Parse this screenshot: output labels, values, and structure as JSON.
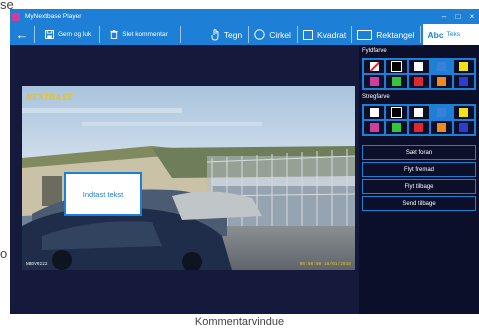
{
  "background": {
    "top_text": "se",
    "mid_text": "o"
  },
  "window": {
    "title": "MyNextbase Player",
    "controls": [
      "–",
      "□",
      "×"
    ]
  },
  "toolbar": {
    "back_icon": "back-arrow-icon",
    "save_close": "Gem og luk",
    "delete_comment": "Slet kommentar",
    "draw": "Tegn",
    "circle": "Cirkel",
    "square": "Kvadrat",
    "rectangle": "Rektangel",
    "text_icon": "Abc",
    "text": "Teks"
  },
  "video": {
    "logo": "NEXTBASE",
    "overlay_left": "NBDVR222",
    "overlay_right": "00:00:00 18/01/2018",
    "text_box": "Indtast tekst"
  },
  "panel": {
    "fill_label": "Fyldfarve",
    "stroke_label": "Stregfarve",
    "fill_colors": [
      "none",
      "#000000",
      "#ffffff",
      "#3a7fd8",
      "#f3e21a",
      "#d23c9c",
      "#36c43a",
      "#e0282e",
      "#f08a1c",
      "#2b3ccf"
    ],
    "fill_selected": 3,
    "stroke_colors": [
      "#ffffff",
      "#000000",
      "#ffffff",
      "#3a7fd8",
      "#f3e21a",
      "#d23c9c",
      "#36c43a",
      "#e0282e",
      "#f08a1c",
      "#2b3ccf"
    ],
    "stroke_selected": 3,
    "bring_front": "Sæt foran",
    "move_forward": "Flyt fremad",
    "move_back": "Flyt tilbage",
    "send_back": "Send tilbage"
  },
  "caption": "Kommentarvindue"
}
